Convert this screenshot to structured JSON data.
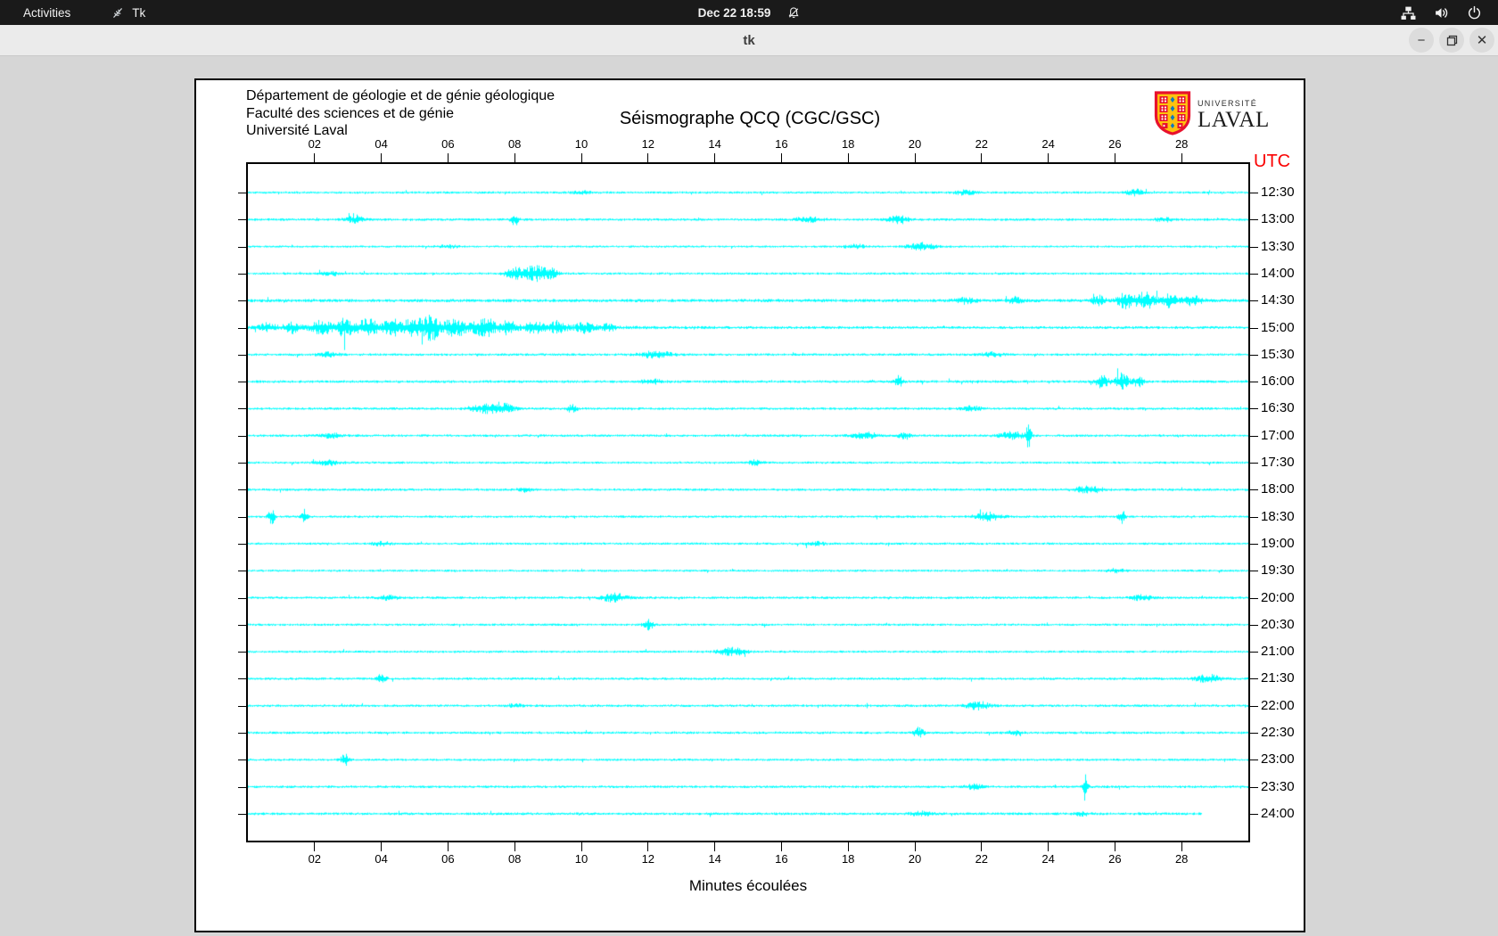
{
  "topbar": {
    "activities": "Activities",
    "app_name": "Tk",
    "clock": "Dec 22  18:59"
  },
  "titlebar": {
    "title": "tk",
    "minimize_glyph": "−",
    "close_glyph": "✕"
  },
  "panel": {
    "header_lines": [
      "Département de géologie et de génie géologique",
      "Faculté des sciences et de génie",
      "Université Laval"
    ],
    "title": "Séismographe QCQ (CGC/GSC)",
    "logo": {
      "small": "UNIVERSITÉ",
      "large": "LAVAL"
    },
    "utc_label": "UTC"
  },
  "chart_data": {
    "type": "line",
    "subtype": "seismogram-helicorder",
    "title": "Séismographe QCQ (CGC/GSC)",
    "xlabel": "Minutes écoulées",
    "right_axis_title": "UTC",
    "x_range": [
      0,
      30
    ],
    "x_tick_minutes": [
      2,
      4,
      6,
      8,
      10,
      12,
      14,
      16,
      18,
      20,
      22,
      24,
      26,
      28
    ],
    "x_ticks": [
      "02",
      "04",
      "06",
      "08",
      "10",
      "12",
      "14",
      "16",
      "18",
      "20",
      "22",
      "24",
      "26",
      "28"
    ],
    "grid": false,
    "trace_color": "#00ffff",
    "background": "#ffffff",
    "rows": [
      {
        "label": "12:30",
        "base": 1.3,
        "end": 30,
        "events": [
          [
            10,
            0.3,
            1.5
          ],
          [
            21.5,
            0.3,
            2.5
          ],
          [
            26.6,
            0.25,
            3.5
          ]
        ]
      },
      {
        "label": "13:00",
        "base": 1.4,
        "end": 30,
        "events": [
          [
            3.2,
            0.3,
            3.5
          ],
          [
            8.0,
            0.12,
            6
          ],
          [
            16.8,
            0.4,
            3
          ],
          [
            19.5,
            0.3,
            4.5
          ],
          [
            27.5,
            0.3,
            2
          ]
        ]
      },
      {
        "label": "13:30",
        "base": 1.2,
        "end": 30,
        "events": [
          [
            6,
            0.3,
            1.5
          ],
          [
            18.2,
            0.3,
            2.5
          ],
          [
            20.2,
            0.4,
            4
          ]
        ]
      },
      {
        "label": "14:00",
        "base": 1.3,
        "end": 30,
        "events": [
          [
            2.5,
            0.3,
            2
          ],
          [
            8.0,
            0.3,
            6
          ],
          [
            8.6,
            0.35,
            9
          ],
          [
            9.1,
            0.2,
            5
          ]
        ]
      },
      {
        "label": "14:30",
        "base": 1.8,
        "end": 30,
        "events": [
          [
            21.5,
            0.3,
            3
          ],
          [
            23.0,
            0.2,
            3.5
          ],
          [
            25.5,
            0.2,
            5
          ],
          [
            26.3,
            0.25,
            8
          ],
          [
            26.9,
            0.3,
            9
          ],
          [
            27.6,
            0.25,
            7
          ],
          [
            28.3,
            0.3,
            5
          ]
        ]
      },
      {
        "label": "15:00",
        "base": 1.6,
        "end": 30,
        "events": [
          [
            5,
            4.5,
            2.5
          ],
          [
            0.6,
            0.25,
            4
          ],
          [
            1.3,
            0.2,
            5
          ],
          [
            2.2,
            0.3,
            6
          ],
          [
            2.9,
            0.25,
            8
          ],
          [
            3.6,
            0.3,
            8
          ],
          [
            4.3,
            0.25,
            7
          ],
          [
            5.0,
            0.3,
            10
          ],
          [
            5.5,
            0.18,
            13
          ],
          [
            6.2,
            0.4,
            7
          ],
          [
            7.1,
            0.3,
            9
          ],
          [
            7.8,
            0.25,
            6
          ],
          [
            8.6,
            0.3,
            5
          ],
          [
            9.3,
            0.25,
            6
          ],
          [
            10.1,
            0.3,
            5
          ],
          [
            10.8,
            0.2,
            4
          ]
        ]
      },
      {
        "label": "15:30",
        "base": 1.4,
        "end": 30,
        "events": [
          [
            2.4,
            0.3,
            2.5
          ],
          [
            12.2,
            0.5,
            3.5
          ],
          [
            22.3,
            0.3,
            2.5
          ]
        ]
      },
      {
        "label": "16:00",
        "base": 1.5,
        "end": 30,
        "events": [
          [
            12.1,
            0.3,
            2.5
          ],
          [
            19.5,
            0.12,
            6
          ],
          [
            25.6,
            0.2,
            7
          ],
          [
            26.2,
            0.2,
            9
          ],
          [
            26.7,
            0.15,
            6
          ]
        ]
      },
      {
        "label": "16:30",
        "base": 1.4,
        "end": 30,
        "events": [
          [
            7.0,
            0.4,
            4
          ],
          [
            7.6,
            0.35,
            6
          ],
          [
            9.7,
            0.15,
            4
          ],
          [
            21.7,
            0.3,
            2.5
          ]
        ]
      },
      {
        "label": "17:00",
        "base": 1.4,
        "end": 30,
        "events": [
          [
            2.5,
            0.3,
            2.5
          ],
          [
            18.5,
            0.4,
            3.5
          ],
          [
            19.7,
            0.2,
            3.5
          ],
          [
            22.9,
            0.4,
            4
          ],
          [
            23.4,
            0.08,
            13
          ]
        ]
      },
      {
        "label": "17:30",
        "base": 1.3,
        "end": 30,
        "events": [
          [
            2.4,
            0.4,
            2.5
          ],
          [
            15.2,
            0.2,
            3
          ]
        ]
      },
      {
        "label": "18:00",
        "base": 1.4,
        "end": 30,
        "events": [
          [
            8.3,
            0.2,
            2.5
          ],
          [
            25.2,
            0.4,
            4
          ]
        ]
      },
      {
        "label": "18:30",
        "base": 1.3,
        "end": 30,
        "events": [
          [
            0.7,
            0.1,
            8
          ],
          [
            1.7,
            0.1,
            7
          ],
          [
            22.2,
            0.4,
            4.5
          ],
          [
            26.2,
            0.1,
            7
          ]
        ]
      },
      {
        "label": "19:00",
        "base": 1.3,
        "end": 30,
        "events": [
          [
            4,
            0.3,
            2
          ],
          [
            17,
            0.3,
            2
          ]
        ]
      },
      {
        "label": "19:30",
        "base": 1.2,
        "end": 30,
        "events": [
          [
            26,
            0.3,
            2
          ]
        ]
      },
      {
        "label": "20:00",
        "base": 1.4,
        "end": 30,
        "events": [
          [
            4.2,
            0.3,
            2.5
          ],
          [
            11.0,
            0.4,
            4.5
          ],
          [
            26.8,
            0.3,
            3
          ]
        ]
      },
      {
        "label": "20:30",
        "base": 1.3,
        "end": 30,
        "events": [
          [
            12.0,
            0.15,
            5.5
          ]
        ]
      },
      {
        "label": "21:00",
        "base": 1.3,
        "end": 30,
        "events": [
          [
            14.5,
            0.4,
            4.5
          ]
        ]
      },
      {
        "label": "21:30",
        "base": 1.4,
        "end": 30,
        "events": [
          [
            4.0,
            0.12,
            6.5
          ],
          [
            28.8,
            0.4,
            4.5
          ]
        ]
      },
      {
        "label": "22:00",
        "base": 1.4,
        "end": 30,
        "events": [
          [
            8,
            0.2,
            2
          ],
          [
            21.9,
            0.35,
            4.5
          ]
        ]
      },
      {
        "label": "22:30",
        "base": 1.4,
        "end": 30,
        "events": [
          [
            20.1,
            0.15,
            5.5
          ],
          [
            23,
            0.2,
            2.5
          ]
        ]
      },
      {
        "label": "23:00",
        "base": 1.3,
        "end": 30,
        "events": [
          [
            2.9,
            0.12,
            6.5
          ]
        ]
      },
      {
        "label": "23:30",
        "base": 1.4,
        "end": 30,
        "events": [
          [
            21.8,
            0.3,
            2.5
          ],
          [
            25.1,
            0.07,
            16
          ]
        ]
      },
      {
        "label": "24:00",
        "base": 1.5,
        "end": 28.6,
        "events": [
          [
            20.2,
            0.3,
            2.5
          ],
          [
            25,
            0.2,
            2
          ]
        ]
      }
    ]
  }
}
